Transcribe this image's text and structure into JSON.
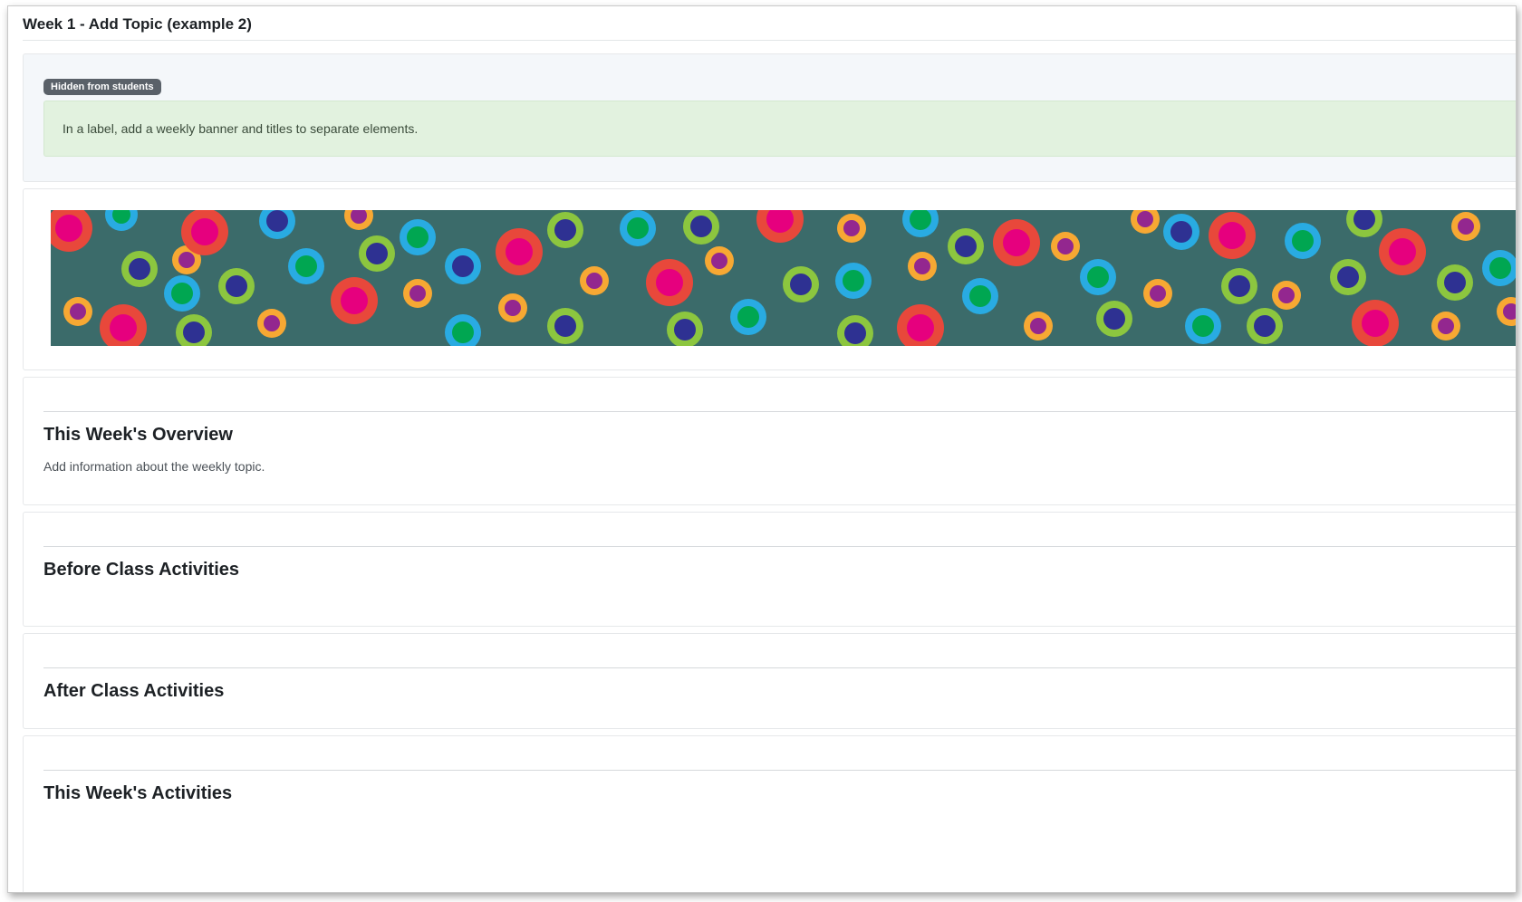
{
  "section": {
    "title": "Week 1 - Add Topic (example 2)"
  },
  "restricted": {
    "badge": "Hidden from students",
    "note": "In a label, add a weekly banner and titles to separate elements."
  },
  "banner": {
    "description_icon": "polka-dot-banner-image",
    "background_color": "#3b6b6a",
    "palette": [
      "#e8483b",
      "#e6007e",
      "#8cc63f",
      "#29abe2",
      "#2e3192",
      "#00a651",
      "#f7a833",
      "#93278f"
    ]
  },
  "labels": [
    {
      "heading": "This Week's Overview",
      "text": "Add information about the weekly topic."
    },
    {
      "heading": "Before Class Activities",
      "text": ""
    },
    {
      "heading": "After Class Activities",
      "text": ""
    },
    {
      "heading": "This Week's Activities",
      "text": ""
    }
  ]
}
